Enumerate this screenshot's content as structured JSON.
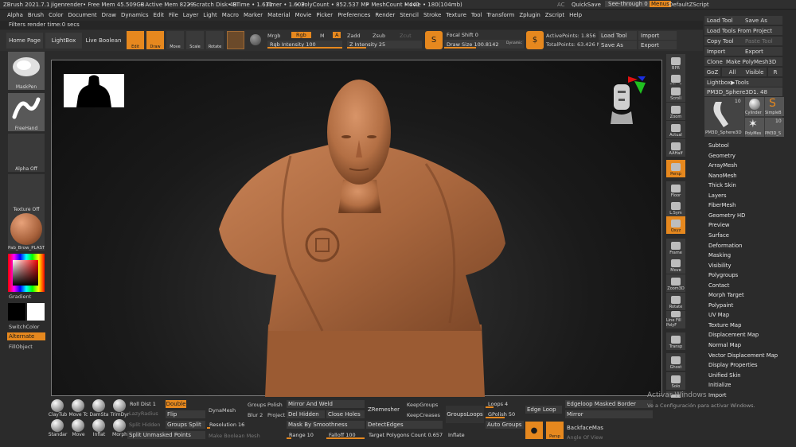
{
  "titlebar": {
    "app": "ZBrush 2021.7.1",
    "user": "jigenrender",
    "free_mem": "• Free Mem 45.509GB",
    "active_mem": "• Active Mem 8229",
    "scratch": "• Scratch Disk 49",
    "rtime": "• RTime • 1.631",
    "timer": "Timer • 1.603",
    "polycount": "• PolyCount • 852.537 MP",
    "meshcount": "• MeshCount • 441",
    "movie": "Movie • 180(104mb)",
    "ac": "AC",
    "quicksave": "QuickSave",
    "see_through": "See-through  0",
    "menus": "Menus",
    "script": "DefaultZScript"
  },
  "menubar": [
    "Alpha",
    "Brush",
    "Color",
    "Document",
    "Draw",
    "Dynamics",
    "Edit",
    "File",
    "Layer",
    "Light",
    "Macro",
    "Marker",
    "Material",
    "Movie",
    "Picker",
    "Preferences",
    "Render",
    "Stencil",
    "Stroke",
    "Texture",
    "Tool",
    "Transform",
    "Zplugin",
    "Zscript",
    "Help"
  ],
  "status_line": "Filters render time:0 secs",
  "top_shelf": {
    "home_page": "Home Page",
    "lightbox": "LightBox",
    "live_boolean": "Live Boolean",
    "edit": "Edit",
    "draw": "Draw",
    "move": "Move",
    "scale": "Scale",
    "rotate": "Rotate",
    "mrgb": "Mrgb",
    "rgb": "Rgb",
    "m": "M",
    "a": "A",
    "zadd": "Zadd",
    "zsub": "Zsub",
    "zcut": "Zcut",
    "rgb_intensity": "Rgb Intensity 100",
    "z_intensity": "Z Intensity 25",
    "focal_shift": "Focal Shift 0",
    "draw_size": "Draw Size 100.8142",
    "dynamic": "Dynamic",
    "active_points": "ActivePoints: 1.856",
    "total_points": "TotalPoints: 63.426 Mil",
    "load_tool": "Load Tool",
    "import": "Import",
    "save_as": "Save As",
    "export": "Export"
  },
  "left_shelf": {
    "brush1": "MaskPen",
    "brush2": "FreeHand",
    "alpha": "Alpha Off",
    "texture": "Texture Off",
    "material": "Pab_Brow_PLAST",
    "gradient": "Gradient",
    "switch_color": "SwitchColor",
    "alternate": "Alternate",
    "fill_object": "FillObject"
  },
  "right_shelf": [
    "BPR",
    "SPix 3",
    "Scroll",
    "Zoom",
    "Actual",
    "AAHalf",
    "Persp",
    "Floor",
    "L.Sym",
    "Qxyz",
    "Frame",
    "Move",
    "Zoom3D",
    "Rotate",
    "Line Fill PolyF",
    "Transp",
    "Ghost",
    "Solo",
    "Xpose"
  ],
  "right_palette": {
    "load_tool": "Load Tool",
    "save_as": "Save As",
    "load_from_project": "Load Tools From Project",
    "copy_tool": "Copy Tool",
    "paste_tool": "Paste Tool",
    "import": "Import",
    "export": "Export",
    "clone": "Clone",
    "make_polymesh": "Make PolyMesh3D",
    "goz": "GoZ",
    "all": "All",
    "visible": "Visible",
    "r": "R",
    "lightbox_tools": "Lightbox▶Tools",
    "current_tool": "PM3D_Sphere3D1. 48",
    "thumb_count1": "10",
    "thumb_count2": "10",
    "thumb1": "PM3D_Sphere3D",
    "thumb2": "Cylinder",
    "thumb3": "SimpleB",
    "thumb4": "PolyMes",
    "thumb5": "PM3D_S",
    "subpalettes": [
      "Subtool",
      "Geometry",
      "ArrayMesh",
      "NanoMesh",
      "Thick Skin",
      "Layers",
      "FiberMesh",
      "Geometry HD",
      "Preview",
      "Surface",
      "Deformation",
      "Masking",
      "Visibility",
      "Polygroups",
      "Contact",
      "Morph Target",
      "Polypaint",
      "UV Map",
      "Texture Map",
      "Displacement Map",
      "Normal Map",
      "Vector Displacement Map",
      "Display Properties",
      "Unified Skin",
      "Initialize",
      "Import",
      "Export"
    ]
  },
  "bottom_shelf": {
    "brushes_top": [
      "ClayTub",
      "Move Tc",
      "DamSta",
      "TrimDyr"
    ],
    "brushes_bottom": [
      "Standar",
      "Move",
      "Inflat",
      "Morph"
    ],
    "roll_dist": "Roll Dist 1",
    "double": "Double",
    "lazy_radius": "LazyRadius",
    "flip": "Flip",
    "split_hidden": "Split Hidden",
    "groups_split": "Groups Split",
    "split_unmasked": "Split Unmasked Points",
    "dynamesh": "DynaMesh",
    "resolution": "Resolution 16",
    "make_boolean": "Make Boolean Mesh",
    "groups": "Groups",
    "polish": "Polish",
    "blur": "Blur 2",
    "project": "Project",
    "mirror_and_weld": "Mirror And Weld",
    "del_hidden": "Del Hidden",
    "close_holes": "Close Holes",
    "mask_by_smoothness": "Mask By Smoothness",
    "range": "Range 10",
    "falloff": "Falloff 100",
    "zremesher": "ZRemesher",
    "keep_groups": "KeepGroups",
    "keep_creases": "KeepCreases",
    "detect_edges": "DetectEdges",
    "target_polygons": "Target Polygons Count 0.65764",
    "groups_loops": "GroupsLoops",
    "loops": "Loops 4",
    "gpolish": "GPolish 50",
    "auto_groups": "Auto Groups",
    "edge_loop": "Edge Loop",
    "inflate": "Inflate",
    "edgeloop_masked": "Edgeloop Masked Border",
    "mirror": "Mirror",
    "backface_mask": "BackfaceMask",
    "angle_of_view": "Angle Of View",
    "persp": "Persp"
  },
  "watermark": {
    "title": "Activar Windows",
    "subtitle": "Ve a Configuración para activar Windows."
  },
  "colors": {
    "accent": "#e6881e",
    "panel": "#3a3a3a",
    "background": "#2b2b2b",
    "canvas": "#0a0a0a",
    "clay": "#b8754a"
  }
}
